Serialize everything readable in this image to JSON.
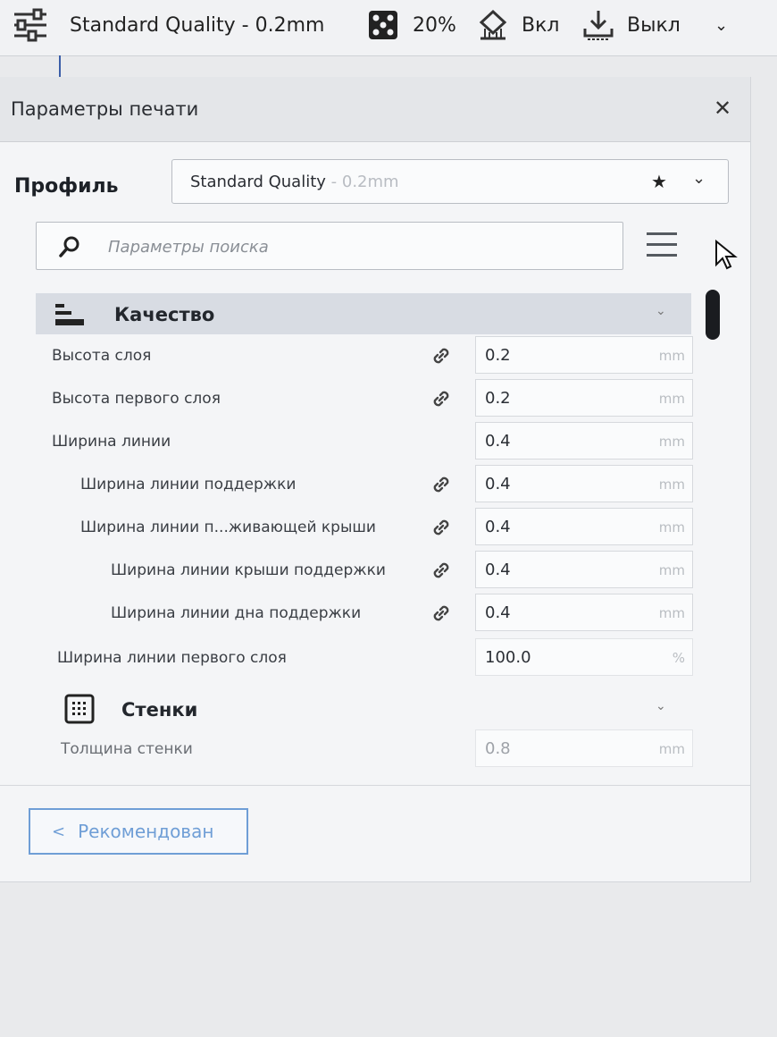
{
  "topbar": {
    "profile": "Standard Quality - 0.2mm",
    "infill": "20%",
    "support": "Вкл",
    "adhesion": "Выкл"
  },
  "panel": {
    "title": "Параметры печати",
    "profile_label": "Профиль",
    "profile_name": "Standard Quality",
    "profile_sub": " - 0.2mm",
    "search_placeholder": "Параметры поиска",
    "categories": {
      "quality": "Качество",
      "walls": "Стенки"
    },
    "settings": [
      {
        "label": "Высота слоя",
        "value": "0.2",
        "unit": "mm"
      },
      {
        "label": "Высота первого слоя",
        "value": "0.2",
        "unit": "mm"
      },
      {
        "label": "Ширина линии",
        "value": "0.4",
        "unit": "mm"
      },
      {
        "label": "Ширина линии поддержки",
        "value": "0.4",
        "unit": "mm"
      },
      {
        "label": "Ширина линии п...живающей крыши",
        "value": "0.4",
        "unit": "mm"
      },
      {
        "label": "Ширина линии крыши поддержки",
        "value": "0.4",
        "unit": "mm"
      },
      {
        "label": "Ширина линии дна поддержки",
        "value": "0.4",
        "unit": "mm"
      },
      {
        "label": "Ширина линии первого слоя",
        "value": "100.0",
        "unit": "%"
      },
      {
        "label": "Толщина стенки",
        "value": "0.8",
        "unit": "mm"
      }
    ],
    "recommended_button": "Рекомендован"
  },
  "icons": [
    "sliders-icon",
    "infill-icon",
    "support-icon",
    "adhesion-icon",
    "chevron-down-icon",
    "close-icon",
    "star-icon",
    "search-icon",
    "menu-icon",
    "link-icon",
    "quality-icon",
    "walls-icon",
    "cursor-icon"
  ]
}
